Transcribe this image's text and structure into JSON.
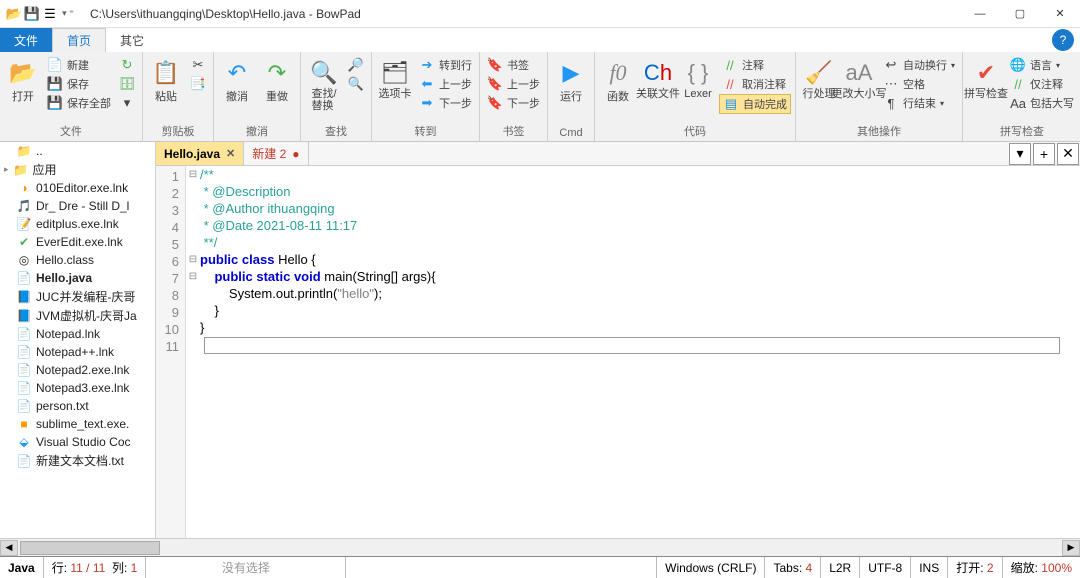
{
  "title": "C:\\Users\\ithuangqing\\Desktop\\Hello.java - BowPad",
  "ribbon_tabs": {
    "file": "文件",
    "home": "首页",
    "other": "其它"
  },
  "ribbon": {
    "file": {
      "label": "文件",
      "open": "打开",
      "new": "新建",
      "save": "保存",
      "save_all": "保存全部"
    },
    "clipboard": {
      "label": "剪贴板",
      "paste": "粘贴"
    },
    "undo": {
      "label": "撤消",
      "undo": "撤消",
      "redo": "重做"
    },
    "find": {
      "label": "查找",
      "find_replace": "查找/\n替换"
    },
    "options": {
      "label": "转到",
      "tabs": "选项卡",
      "goline": "转到行",
      "prev": "上一步",
      "next": "下一步"
    },
    "bookmark": {
      "label": "书签",
      "bookmark": "书签",
      "up": "上一步",
      "down": "下一步"
    },
    "cmd": {
      "label": "Cmd",
      "run": "运行"
    },
    "code": {
      "label": "代码",
      "func": "函数",
      "relfiles": "关联文件",
      "lexer": "Lexer",
      "comment": "注释",
      "uncomment": "取消注释",
      "autocomplete": "自动完成"
    },
    "misc": {
      "label": "其他操作",
      "trim": "行处理",
      "case": "更改大小写",
      "autowrap": "自动换行",
      "whitespace": "空格",
      "lineend": "行结束"
    },
    "spell": {
      "label": "拼写检查",
      "spell": "拼写检查",
      "lang": "语言",
      "commentonly": "仅注释",
      "upper": "包括大写"
    }
  },
  "sidebar": [
    {
      "name": "..",
      "icon": "📁",
      "class": "folder-y"
    },
    {
      "name": "应用",
      "icon": "📁",
      "class": "folder-y",
      "tree": true
    },
    {
      "name": "010Editor.exe.lnk",
      "icon": "◑",
      "class": "orange"
    },
    {
      "name": "Dr_ Dre - Still D_l",
      "icon": "🎵",
      "class": "red"
    },
    {
      "name": "editplus.exe.lnk",
      "icon": "📝",
      "class": "green"
    },
    {
      "name": "EverEdit.exe.lnk",
      "icon": "✔",
      "class": "green"
    },
    {
      "name": "Hello.class",
      "icon": "◎",
      "class": ""
    },
    {
      "name": "Hello.java",
      "icon": "📄",
      "class": "",
      "bold": true
    },
    {
      "name": "JUC并发编程-庆哥",
      "icon": "📘",
      "class": "blue"
    },
    {
      "name": "JVM虚拟机-庆哥Ja",
      "icon": "📘",
      "class": "blue"
    },
    {
      "name": "Notepad.lnk",
      "icon": "📄",
      "class": ""
    },
    {
      "name": "Notepad++.lnk",
      "icon": "📄",
      "class": "green"
    },
    {
      "name": "Notepad2.exe.lnk",
      "icon": "📄",
      "class": ""
    },
    {
      "name": "Notepad3.exe.lnk",
      "icon": "📄",
      "class": ""
    },
    {
      "name": "person.txt",
      "icon": "📄",
      "class": ""
    },
    {
      "name": "sublime_text.exe.",
      "icon": "■",
      "class": "orange"
    },
    {
      "name": "Visual Studio Coc",
      "icon": "⬙",
      "class": "blue"
    },
    {
      "name": "新建文本文档.txt",
      "icon": "📄",
      "class": ""
    }
  ],
  "tabs": [
    {
      "label": "Hello.java",
      "active": true
    },
    {
      "label": "新建 2",
      "unsaved": true
    }
  ],
  "code_lines": [
    {
      "n": 1,
      "fold": "-",
      "html": "<span class='c-doc'>/**</span>"
    },
    {
      "n": 2,
      "fold": "",
      "html": "<span class='c-doc'> * @Description</span>"
    },
    {
      "n": 3,
      "fold": "",
      "html": "<span class='c-doc'> * @Author ithuangqing</span>"
    },
    {
      "n": 4,
      "fold": "",
      "html": "<span class='c-doc'> * @Date 2021-08-11 11:17</span>"
    },
    {
      "n": 5,
      "fold": "",
      "html": "<span class='c-doc'> **/</span>"
    },
    {
      "n": 6,
      "fold": "-",
      "html": "<span class='c-kw'>public</span> <span class='c-kw'>class</span> Hello {"
    },
    {
      "n": 7,
      "fold": "-",
      "html": "    <span class='c-kw'>public</span> <span class='c-kw'>static</span> <span class='c-kw'>void</span> main(String[] args){"
    },
    {
      "n": 8,
      "fold": "",
      "html": "        System.out.println(<span class='c-str'>\"hello\"</span>);"
    },
    {
      "n": 9,
      "fold": "",
      "html": "    }"
    },
    {
      "n": 10,
      "fold": "",
      "html": "}"
    },
    {
      "n": 11,
      "fold": "",
      "html": ""
    }
  ],
  "status": {
    "lang": "Java",
    "line": "行:",
    "line_v": "11 / 11",
    "col": "列:",
    "col_v": "1",
    "noselect": "没有选择",
    "eol": "Windows (CRLF)",
    "tabs": "Tabs:",
    "tabs_v": "4",
    "dir": "L2R",
    "enc": "UTF-8",
    "ins": "INS",
    "open": "打开:",
    "open_v": "2",
    "zoom": "缩放:",
    "zoom_v": "100%"
  }
}
